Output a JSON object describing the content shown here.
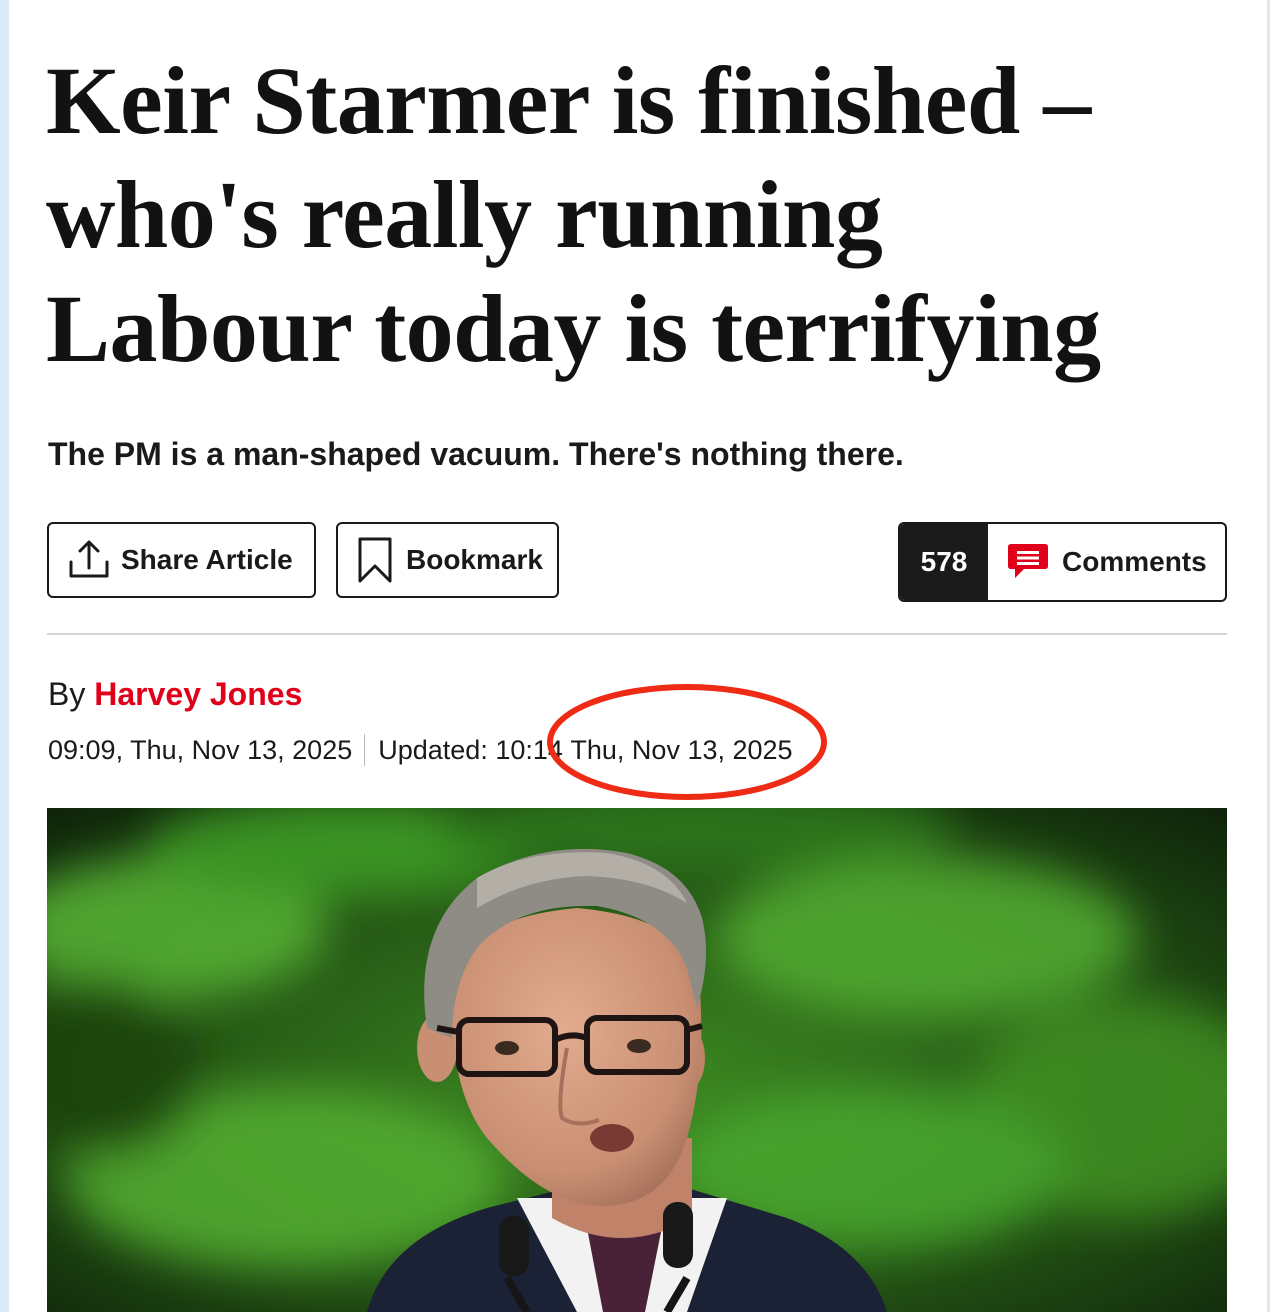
{
  "article": {
    "headline": "Keir Starmer is finished – who's really running Labour today is terrifying",
    "standfirst": "The PM is a man-shaped vacuum. There's nothing there."
  },
  "actions": {
    "share_label": "Share Article",
    "bookmark_label": "Bookmark",
    "comments_count": "578",
    "comments_label": "Comments"
  },
  "byline": {
    "prefix": "By",
    "author": "Harvey Jones",
    "published": "09:09, Thu, Nov 13, 2025",
    "updated_label": "Updated: 10:14",
    "updated_date": "Thu, Nov 13, 2025"
  },
  "icons": {
    "share": "share-upload-icon",
    "bookmark": "bookmark-icon",
    "comments": "speech-bubble-icon"
  },
  "colors": {
    "author_link": "#e1001a",
    "comments_icon": "#e1001a",
    "annotation_circle": "#ee2b14",
    "count_background": "#1a1a1a"
  }
}
